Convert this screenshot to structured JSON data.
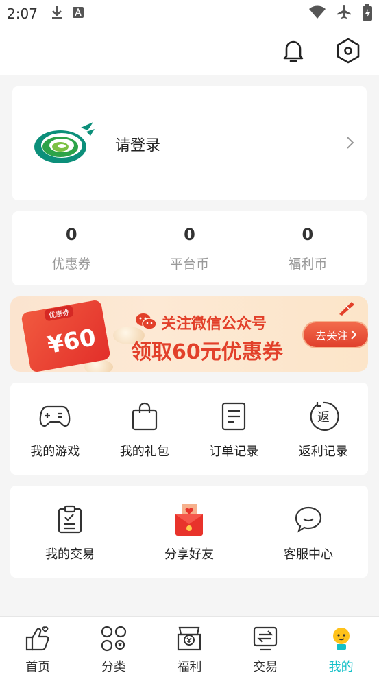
{
  "status_bar": {
    "time": "2:07",
    "icons": [
      "download-icon",
      "text-a-icon",
      "wifi-icon",
      "airplane-icon",
      "battery-icon"
    ]
  },
  "header": {
    "icons": [
      "bell-icon",
      "settings-hexagon-icon"
    ]
  },
  "login": {
    "prompt": "请登录"
  },
  "stats": [
    {
      "value": "0",
      "label": "优惠券"
    },
    {
      "value": "0",
      "label": "平台币"
    },
    {
      "value": "0",
      "label": "福利币"
    }
  ],
  "banner": {
    "coupon_tag": "优惠券",
    "coupon_amount": "¥60",
    "line1": "关注微信公众号",
    "line2": "领取60元优惠券",
    "button": "去关注"
  },
  "menu1": [
    {
      "label": "我的游戏",
      "icon": "gamepad-icon"
    },
    {
      "label": "我的礼包",
      "icon": "gift-bag-icon"
    },
    {
      "label": "订单记录",
      "icon": "order-document-icon"
    },
    {
      "label": "返利记录",
      "icon": "rebate-icon",
      "glyph": "返"
    }
  ],
  "menu2": [
    {
      "label": "我的交易",
      "icon": "clipboard-check-icon"
    },
    {
      "label": "分享好友",
      "icon": "red-envelope-icon"
    },
    {
      "label": "客服中心",
      "icon": "chat-bubble-icon"
    }
  ],
  "tabs": [
    {
      "label": "首页",
      "icon": "thumbs-up-icon",
      "active": false
    },
    {
      "label": "分类",
      "icon": "grid-icon",
      "active": false
    },
    {
      "label": "福利",
      "icon": "gift-yen-icon",
      "active": false
    },
    {
      "label": "交易",
      "icon": "exchange-icon",
      "active": false
    },
    {
      "label": "我的",
      "icon": "mascot-icon",
      "active": true
    }
  ],
  "colors": {
    "accent": "#14c0c8",
    "banner_red": "#e2402a",
    "background": "#f5f5f5"
  }
}
